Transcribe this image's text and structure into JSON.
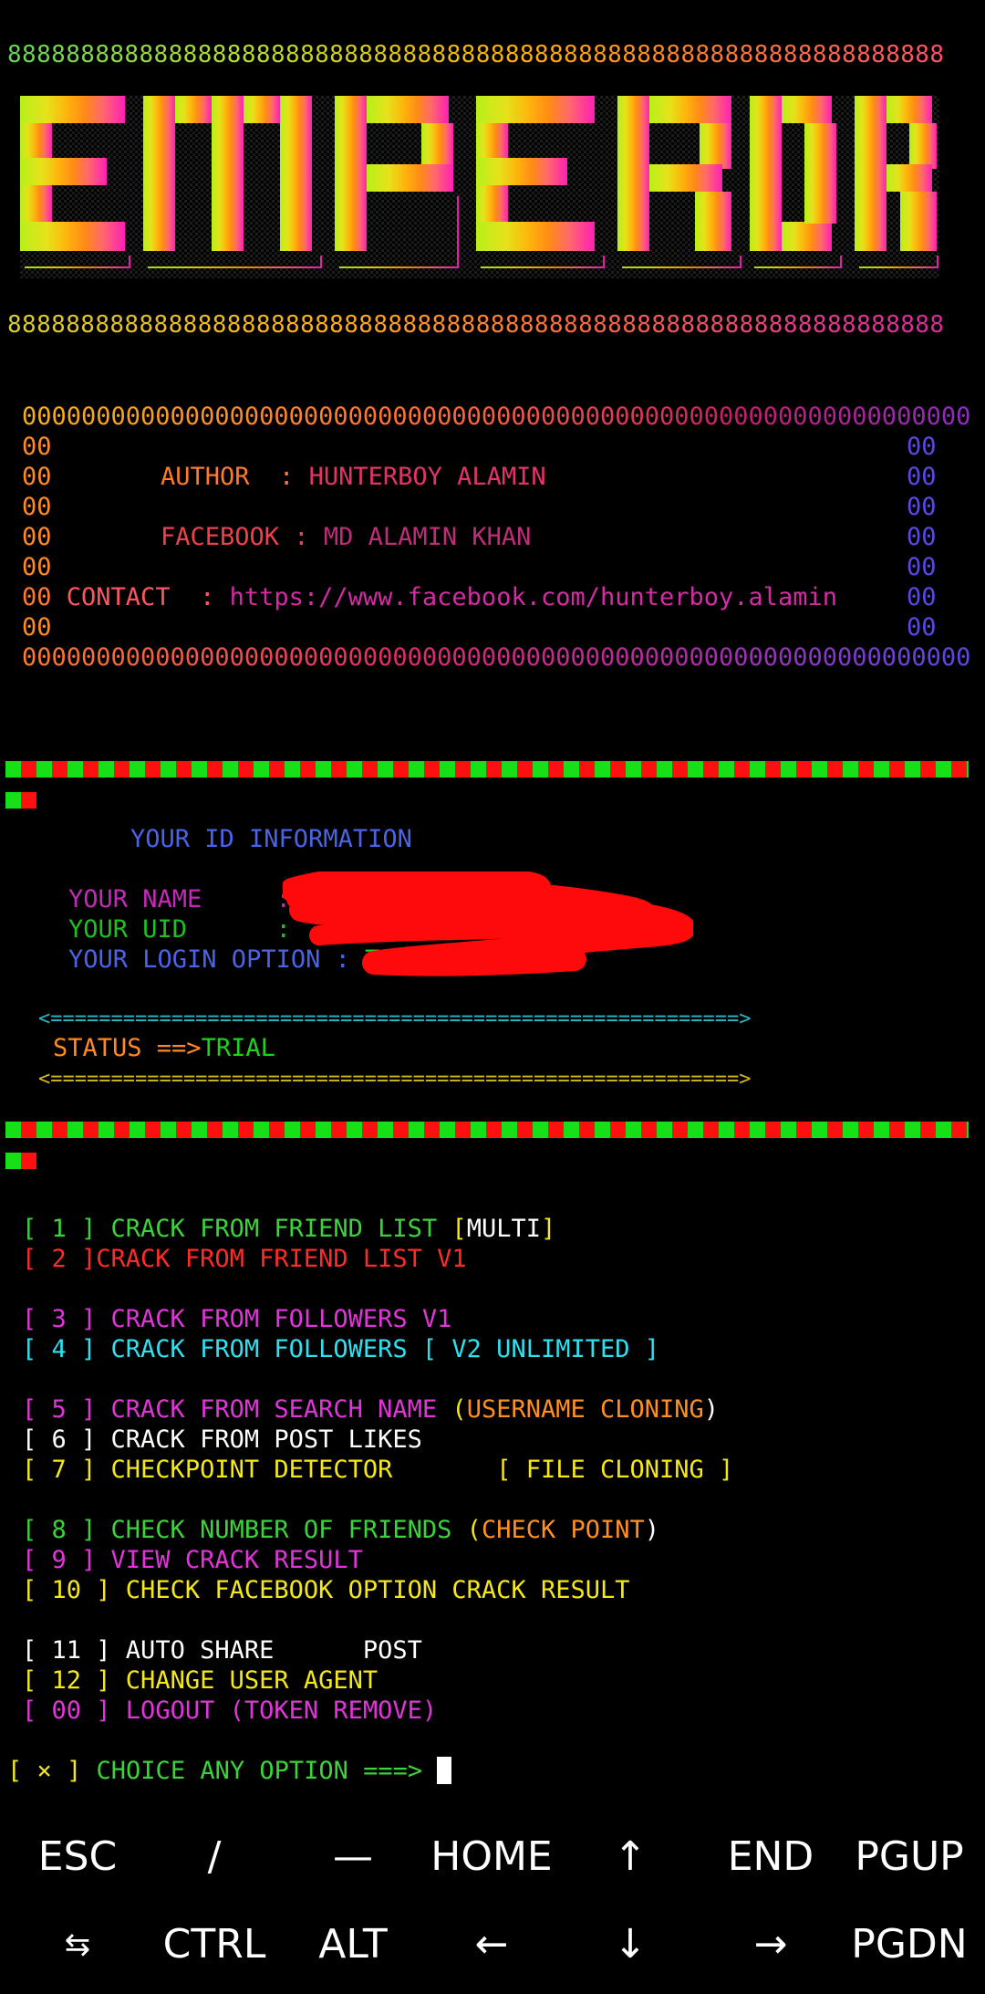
{
  "banner": {
    "line_top": "8888888888888888888888888888888888888888888888888888888888888888",
    "line_bottom": "8888888888888888888888888888888888888888888888888888888888888888",
    "logo_text": "EMPEROR"
  },
  "info_box": {
    "border": "0000000000000000000000000000000000000000000000000000000000000000",
    "edge": "00",
    "author_label": "AUTHOR  : ",
    "author_value": "HUNTERBOY ALAMIN",
    "facebook_label": "FACEBOOK : ",
    "facebook_value": "MD ALAMIN KHAN",
    "contact_label": "CONTACT  : ",
    "contact_value": "https://www.facebook.com/hunterboy.alamin"
  },
  "id_info": {
    "heading": "YOUR ID INFORMATION",
    "name_label": "YOUR NAME     :",
    "uid_label": "YOUR UID      :",
    "login_label": "YOUR LOGIN OPTION : ",
    "login_value": "TOKE",
    "arrow_line": "<=========================================================>",
    "status_label": "STATUS ==>",
    "status_value": "TRIAL"
  },
  "menu": {
    "o1_num": "[ 1 ]",
    "o1_text": " CRACK FROM FRIEND LIST ",
    "o1_tag_open": "[",
    "o1_tag": "MULTI",
    "o1_tag_close": "]",
    "o2_num": "[ 2 ]",
    "o2_text": "CRACK FROM FRIEND LIST V1",
    "o3_num": "[ 3 ]",
    "o3_text": " CRACK FROM FOLLOWERS V1",
    "o4_num": "[ 4 ]",
    "o4_text": " CRACK FROM FOLLOWERS ",
    "o4_tag": "[ V2 UNLIMITED ]",
    "o5_num": "[ 5 ]",
    "o5_text": " CRACK FROM SEARCH NAME ",
    "o5_paren_open": "(",
    "o5_tag": "USERNAME CLONING",
    "o5_paren_close": ")",
    "o6_num": "[ 6 ]",
    "o6_text": " CRACK FROM POST LIKES",
    "o7_num": "[ 7 ]",
    "o7_text": " CHECKPOINT DETECTOR       ",
    "o7_tag": "[ FILE CLONING ]",
    "o8_num": "[ 8 ]",
    "o8_text": " CHECK NUMBER OF FRIENDS ",
    "o8_paren_open": "(",
    "o8_tag": "CHECK POINT",
    "o8_paren_close": ")",
    "o9_num": "[ 9 ]",
    "o9_text": " VIEW CRACK RESULT",
    "o10_num": "[ 10 ]",
    "o10_text": " CHECK FACEBOOK OPTION CRACK RESULT",
    "o11_num": "[ 11 ]",
    "o11_text": " AUTO SHARE      POST",
    "o12_num": "[ 12 ]",
    "o12_text": " CHANGE USER AGENT",
    "o00_num": "[ 00 ]",
    "o00_text": " LOGOUT (TOKEN REMOVE)"
  },
  "prompt": {
    "marker": "[ × ]",
    "text": " CHOICE ANY OPTION ===> "
  },
  "extra_keys": {
    "row1": [
      "ESC",
      "/",
      "—",
      "HOME",
      "↑",
      "END",
      "PGUP"
    ],
    "row2": [
      "⇆",
      "CTRL",
      "ALT",
      "←",
      "↓",
      "→",
      "PGDN"
    ]
  },
  "colors": {
    "green": "#3ad43a",
    "red": "#ff2a2a",
    "magenta": "#e035d8",
    "cyan": "#2ee0f0",
    "yellow": "#f4e81a",
    "orange": "#ff9020",
    "white": "#ffffff",
    "blue": "#4b63e6"
  }
}
